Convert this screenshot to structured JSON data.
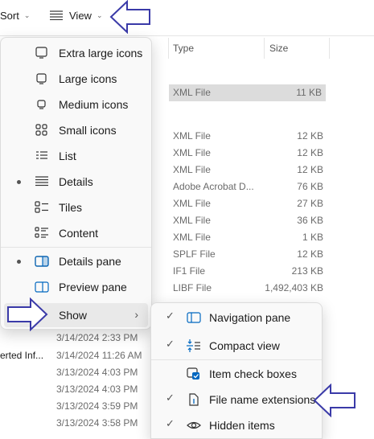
{
  "toolbar": {
    "sort_label": "Sort",
    "view_label": "View",
    "more_label": "···"
  },
  "columns": {
    "type": "Type",
    "size": "Size"
  },
  "files": [
    {
      "type": "XML File",
      "size": "11 KB",
      "selected": true
    },
    {
      "type": "XML File",
      "size": "12 KB"
    },
    {
      "type": "XML File",
      "size": "12 KB"
    },
    {
      "type": "XML File",
      "size": "12 KB"
    },
    {
      "type": "Adobe Acrobat D...",
      "size": "76 KB"
    },
    {
      "type": "XML File",
      "size": "27 KB"
    },
    {
      "type": "XML File",
      "size": "36 KB"
    },
    {
      "type": "XML File",
      "size": "1 KB"
    },
    {
      "type": "SPLF File",
      "size": "12 KB"
    },
    {
      "type": "IF1 File",
      "size": "213 KB"
    },
    {
      "type": "LIBF File",
      "size": "1,492,403 KB"
    }
  ],
  "date_rows": [
    {
      "name": "",
      "date": "3/14/2024 2:33 PM"
    },
    {
      "name": "erted Inf...",
      "date": "3/14/2024 11:26 AM"
    },
    {
      "name": "",
      "date": "3/13/2024 4:03 PM"
    },
    {
      "name": "",
      "date": "3/13/2024 4:03 PM"
    },
    {
      "name": "",
      "date": "3/13/2024 3:59 PM"
    },
    {
      "name": "",
      "date": "3/13/2024 3:58 PM"
    }
  ],
  "view_menu": {
    "items": [
      {
        "label": "Extra large icons",
        "icon": "monitor-large-icon"
      },
      {
        "label": "Large icons",
        "icon": "monitor-icon"
      },
      {
        "label": "Medium icons",
        "icon": "monitor-small-icon"
      },
      {
        "label": "Small icons",
        "icon": "grid-icon"
      },
      {
        "label": "List",
        "icon": "list-icon"
      },
      {
        "label": "Details",
        "icon": "details-icon",
        "selected": true
      },
      {
        "label": "Tiles",
        "icon": "tiles-icon"
      },
      {
        "label": "Content",
        "icon": "content-icon"
      }
    ],
    "panes": [
      {
        "label": "Details pane",
        "icon": "details-pane-icon",
        "selected": true
      },
      {
        "label": "Preview pane",
        "icon": "preview-pane-icon"
      }
    ],
    "show_label": "Show"
  },
  "show_menu": {
    "items": [
      {
        "label": "Navigation pane",
        "checked": true,
        "icon": "navigation-pane-icon"
      },
      {
        "label": "Compact view",
        "checked": true,
        "icon": "compact-view-icon"
      },
      {
        "label": "Item check boxes",
        "checked": false,
        "icon": "checkbox-icon"
      },
      {
        "label": "File name extensions",
        "checked": true,
        "icon": "file-extension-icon"
      },
      {
        "label": "Hidden items",
        "checked": true,
        "icon": "eye-icon"
      }
    ]
  },
  "colors": {
    "annotation": "#3a3aa8",
    "annotation_fill": "#ffffff",
    "checkbox_accent": "#0067c0"
  }
}
